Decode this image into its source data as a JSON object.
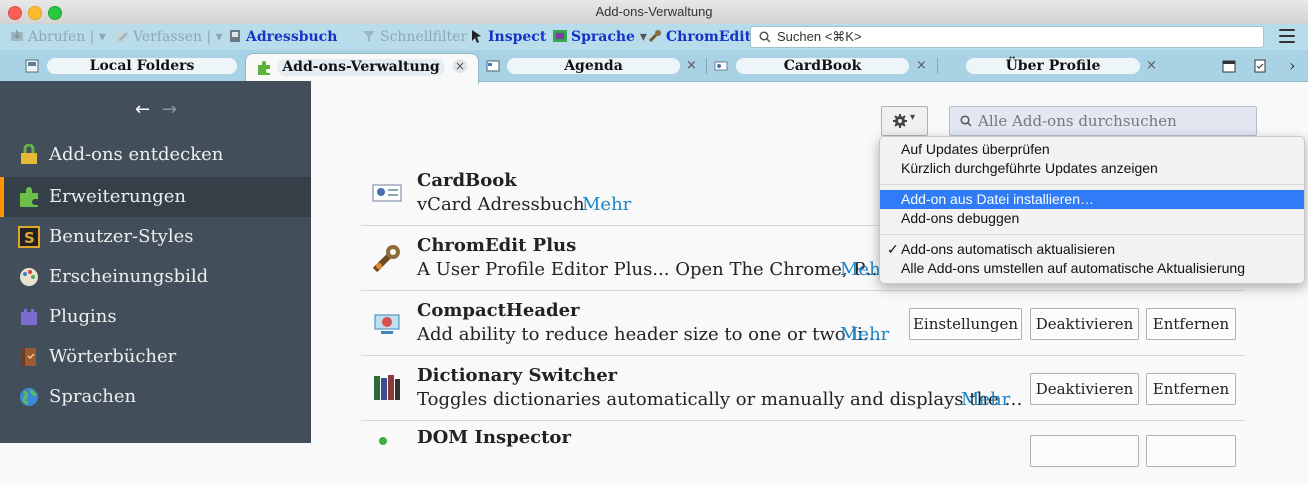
{
  "window": {
    "title": "Add-ons-Verwaltung"
  },
  "toolbar": {
    "abrufen": "Abrufen",
    "verfassen": "Verfassen",
    "adressbuch": "Adressbuch",
    "schnellfilter": "Schnellfilter",
    "inspect": "Inspect",
    "sprache": "Sprache",
    "chromedit": "ChromEdit",
    "search_placeholder": "Suchen <⌘K>"
  },
  "tabs": [
    {
      "label": "Local Folders"
    },
    {
      "label": "Add-ons-Verwaltung"
    },
    {
      "label": "Agenda"
    },
    {
      "label": "CardBook"
    },
    {
      "label": "Über Profile"
    }
  ],
  "sidebar": {
    "items": [
      {
        "label": "Add-ons entdecken"
      },
      {
        "label": "Erweiterungen"
      },
      {
        "label": "Benutzer-Styles"
      },
      {
        "label": "Erscheinungsbild"
      },
      {
        "label": "Plugins"
      },
      {
        "label": "Wörterbücher"
      },
      {
        "label": "Sprachen"
      }
    ]
  },
  "content": {
    "search_placeholder": "Alle Add-ons durchsuchen"
  },
  "addons": [
    {
      "name": "CardBook",
      "desc": "vCard Adressbuch",
      "more": "Mehr"
    },
    {
      "name": "ChromEdit Plus",
      "desc": "A User Profile Editor Plus... Open The Chrome, P…",
      "more": "Mehr"
    },
    {
      "name": "CompactHeader",
      "desc": "Add ability to reduce header size to one or two li…",
      "more": "Mehr",
      "btn_settings": "Einstellungen",
      "btn_disable": "Deaktivieren",
      "btn_remove": "Entfernen"
    },
    {
      "name": "Dictionary Switcher",
      "desc": "Toggles dictionaries automatically or manually and displays the …",
      "more": "Mehr",
      "btn_disable": "Deaktivieren",
      "btn_remove": "Entfernen"
    },
    {
      "name": "DOM Inspector"
    }
  ],
  "menu": {
    "items": [
      "Auf Updates überprüfen",
      "Kürzlich durchgeführte Updates anzeigen",
      "Add-on aus Datei installieren…",
      "Add-ons debuggen",
      "Add-ons automatisch aktualisieren",
      "Alle Add-ons umstellen auf automatische Aktualisierung"
    ],
    "checkmark": "✓"
  },
  "colors": {
    "accent": "#ff9500",
    "highlight": "#2f7cf6",
    "link": "#1a85c8"
  }
}
